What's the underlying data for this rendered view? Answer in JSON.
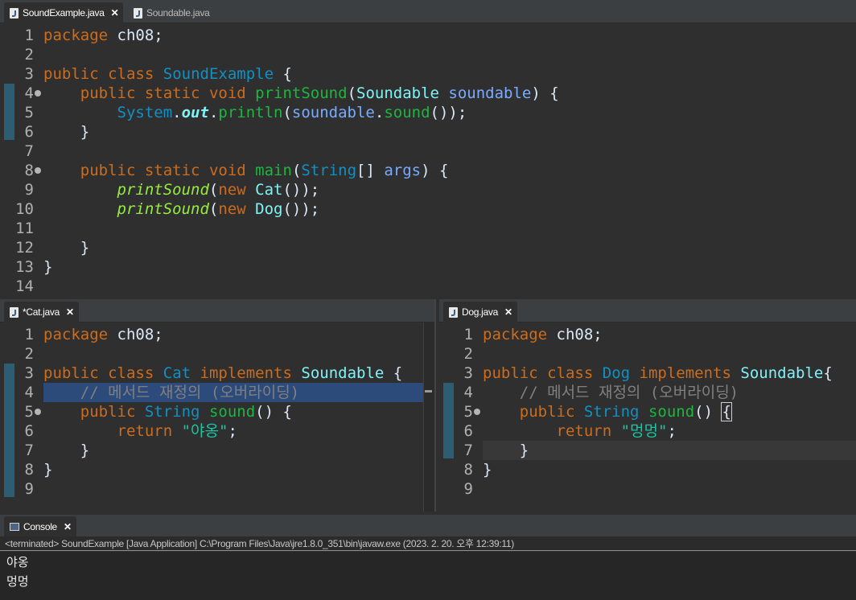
{
  "top_editor": {
    "tabs": [
      {
        "label": "SoundExample.java",
        "active": true
      },
      {
        "label": "Soundable.java",
        "active": false
      }
    ]
  },
  "cat_editor": {
    "tab": {
      "label": "*Cat.java",
      "active": true
    }
  },
  "dog_editor": {
    "tab": {
      "label": "Dog.java",
      "active": true
    }
  },
  "console": {
    "tab_label": "Console",
    "status": "<terminated> SoundExample [Java Application] C:\\Program Files\\Java\\jre1.8.0_351\\bin\\javaw.exe (2023. 2. 20. 오후 12:39:11)",
    "output": [
      "야옹",
      "멍멍"
    ]
  },
  "code": {
    "pkg": "package",
    "pkg_name": "ch08",
    "public": "public",
    "class": "class",
    "static": "static",
    "void": "void",
    "new": "new",
    "return": "return",
    "implements": "implements",
    "sound_example": "SoundExample",
    "print_sound": "printSound",
    "soundable": "Soundable",
    "soundable_param": "soundable",
    "system": "System",
    "out": "out",
    "println": "println",
    "sound": "sound",
    "main": "main",
    "string": "String",
    "args": "args",
    "cat": "Cat",
    "dog": "Dog",
    "comment": "// 메서드 재정의 (오버라이딩)",
    "meow": "\"야옹\"",
    "bark": "\"멍멍\""
  },
  "colors": {
    "keyword": "#cc6c1d",
    "type": "#1290c3",
    "method": "#1eb540",
    "string": "#17c6a3",
    "comment": "#808080",
    "background": "#2f2f2f"
  }
}
